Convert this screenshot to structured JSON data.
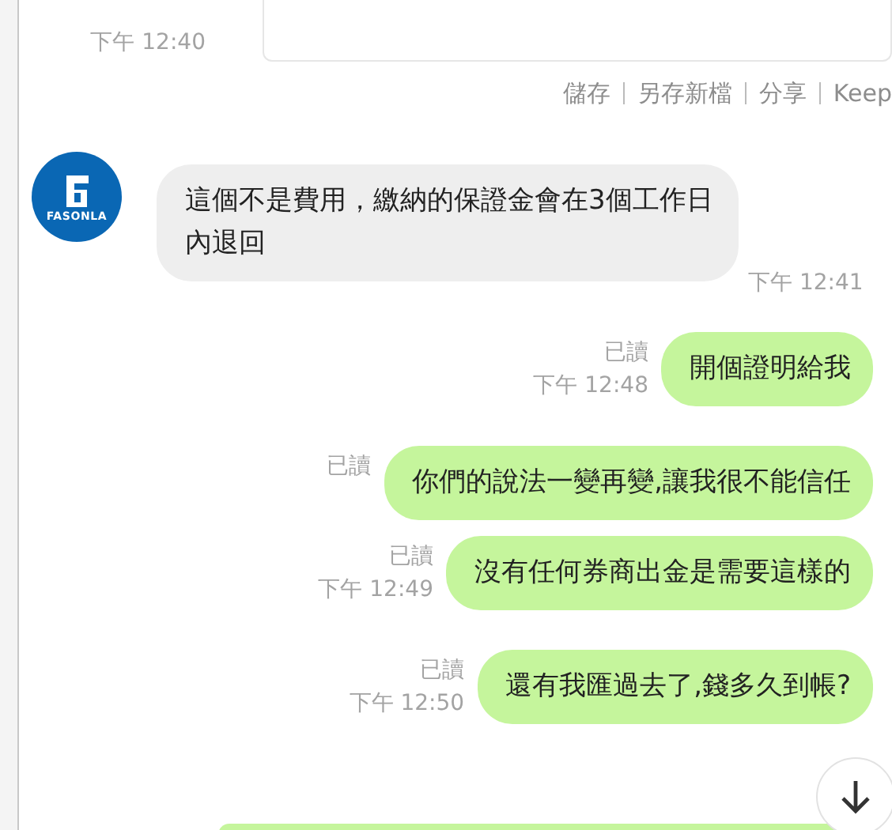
{
  "top_message": {
    "time": "下午 12:40"
  },
  "attachment_actions": [
    "儲存",
    "另存新檔",
    "分享",
    "Keep"
  ],
  "messages": [
    {
      "kind": "incoming",
      "avatar_label": "FASONLA",
      "text": "這個不是費用，繳納的保證金會在3個工作日內退回",
      "time": "下午 12:41"
    },
    {
      "kind": "outgoing",
      "read": "已讀",
      "time": "下午 12:48",
      "text": "開個證明給我"
    },
    {
      "kind": "outgoing",
      "read": "已讀",
      "text": "你們的說法一變再變,讓我很不能信任"
    },
    {
      "kind": "outgoing",
      "read": "已讀",
      "time": "下午 12:49",
      "text": "沒有任何券商出金是需要這樣的"
    },
    {
      "kind": "outgoing",
      "read": "已讀",
      "time": "下午 12:50",
      "text": "還有我匯過去了,錢多久到帳?"
    }
  ]
}
